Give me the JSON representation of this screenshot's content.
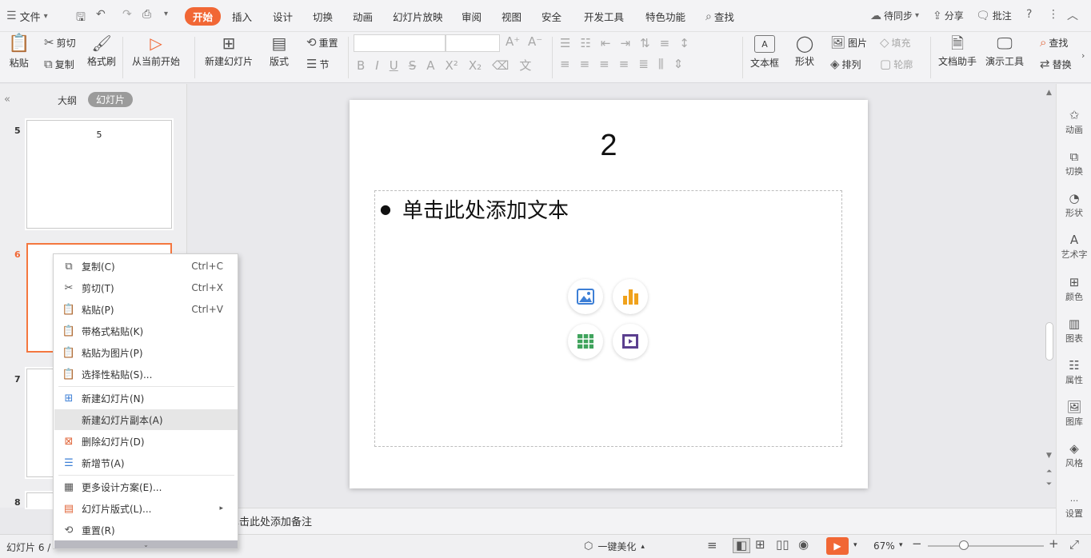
{
  "menubar": {
    "file": "文件",
    "tabs": [
      "开始",
      "插入",
      "设计",
      "切换",
      "动画",
      "幻灯片放映",
      "审阅",
      "视图",
      "安全",
      "开发工具",
      "特色功能"
    ],
    "search": "查找",
    "sync": "待同步",
    "share": "分享",
    "comment": "批注"
  },
  "ribbon": {
    "paste": "粘贴",
    "cut": "剪切",
    "copy": "复制",
    "format_painter": "格式刷",
    "from_current": "从当前开始",
    "new_slide": "新建幻灯片",
    "layout": "版式",
    "reset": "重置",
    "section": "节",
    "textbox": "文本框",
    "shape": "形状",
    "picture": "图片",
    "fill": "填充",
    "arrange": "排列",
    "outline": "轮廓",
    "doc_assistant": "文档助手",
    "presentation_tools": "演示工具",
    "find": "查找",
    "replace": "替换"
  },
  "leftpanel": {
    "tab_outline": "大纲",
    "tab_slides": "幻灯片",
    "slides": [
      {
        "num": "5",
        "title": "5"
      },
      {
        "num": "6",
        "title": ""
      },
      {
        "num": "7",
        "title": ""
      },
      {
        "num": "8",
        "title": ""
      }
    ]
  },
  "slide": {
    "title": "2",
    "body_placeholder": "单击此处添加文本"
  },
  "notes": {
    "placeholder": "单击此处添加备注"
  },
  "context_menu": {
    "items": [
      {
        "label": "复制(C)",
        "shortcut": "Ctrl+C"
      },
      {
        "label": "剪切(T)",
        "shortcut": "Ctrl+X"
      },
      {
        "label": "粘贴(P)",
        "shortcut": "Ctrl+V"
      },
      {
        "label": "带格式粘贴(K)",
        "shortcut": ""
      },
      {
        "label": "粘贴为图片(P)",
        "shortcut": ""
      },
      {
        "label": "选择性粘贴(S)...",
        "shortcut": ""
      },
      {
        "label": "新建幻灯片(N)",
        "shortcut": ""
      },
      {
        "label": "新建幻灯片副本(A)",
        "shortcut": ""
      },
      {
        "label": "删除幻灯片(D)",
        "shortcut": ""
      },
      {
        "label": "新增节(A)",
        "shortcut": ""
      },
      {
        "label": "更多设计方案(E)...",
        "shortcut": ""
      },
      {
        "label": "幻灯片版式(L)...",
        "shortcut": ""
      },
      {
        "label": "重置(R)",
        "shortcut": ""
      }
    ]
  },
  "rightpanel": [
    "动画",
    "切换",
    "形状",
    "艺术字",
    "颜色",
    "图表",
    "属性",
    "图库",
    "风格",
    "设置"
  ],
  "statusbar": {
    "slide_info": "幻灯片 6 /",
    "beautify": "一键美化",
    "zoom": "67%"
  },
  "colors": {
    "accent": "#f16735",
    "selected_border": "#f4773f"
  }
}
